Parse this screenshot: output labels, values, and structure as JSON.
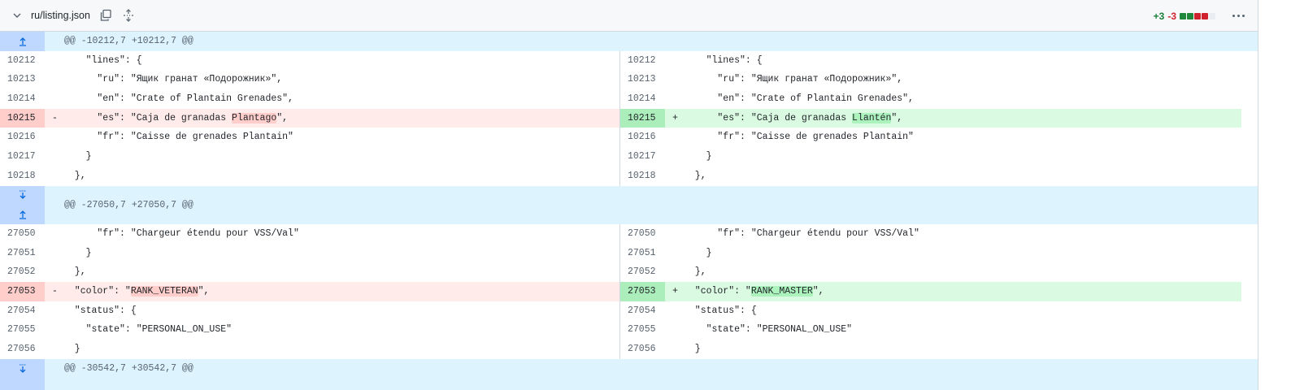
{
  "file": {
    "name": "ru/listing.json",
    "additions": "+3",
    "deletions": "-3",
    "diffstat": [
      "add",
      "add",
      "del",
      "del",
      "neutral"
    ]
  },
  "hunks": [
    {
      "header": "@@ -10212,7 +10212,7 @@",
      "rows": [
        {
          "n": "10212",
          "l": "    \"lines\": {",
          "r": "    \"lines\": {"
        },
        {
          "n": "10213",
          "l": "      \"ru\": \"Ящик гранат «Подорожник»\",",
          "r": "      \"ru\": \"Ящик гранат «Подорожник»\","
        },
        {
          "n": "10214",
          "l": "      \"en\": \"Crate of Plantain Grenades\",",
          "r": "      \"en\": \"Crate of Plantain Grenades\","
        },
        {
          "n": "10215",
          "changed": true,
          "l_pre": "      \"es\": \"Caja de granadas ",
          "l_hl": "Plantago",
          "l_post": "\",",
          "r_pre": "      \"es\": \"Caja de granadas ",
          "r_hl": "Llantén",
          "r_post": "\","
        },
        {
          "n": "10216",
          "l": "      \"fr\": \"Caisse de grenades Plantain\"",
          "r": "      \"fr\": \"Caisse de grenades Plantain\""
        },
        {
          "n": "10217",
          "l": "    }",
          "r": "    }"
        },
        {
          "n": "10218",
          "l": "  },",
          "r": "  },"
        }
      ]
    },
    {
      "header": "@@ -27050,7 +27050,7 @@",
      "rows": [
        {
          "n": "27050",
          "l": "      \"fr\": \"Chargeur étendu pour VSS/Val\"",
          "r": "      \"fr\": \"Chargeur étendu pour VSS/Val\""
        },
        {
          "n": "27051",
          "l": "    }",
          "r": "    }"
        },
        {
          "n": "27052",
          "l": "  },",
          "r": "  },"
        },
        {
          "n": "27053",
          "changed": true,
          "l_pre": "  \"color\": \"",
          "l_hl": "RANK_VETERAN",
          "l_post": "\",",
          "r_pre": "  \"color\": \"",
          "r_hl": "RANK_MASTER",
          "r_post": "\","
        },
        {
          "n": "27054",
          "l": "  \"status\": {",
          "r": "  \"status\": {"
        },
        {
          "n": "27055",
          "l": "    \"state\": \"PERSONAL_ON_USE\"",
          "r": "    \"state\": \"PERSONAL_ON_USE\""
        },
        {
          "n": "27056",
          "l": "  }",
          "r": "  }"
        }
      ]
    },
    {
      "header": "@@ -30542,7 +30542,7 @@",
      "rows": []
    }
  ],
  "markers": {
    "del": "-",
    "add": "+"
  }
}
